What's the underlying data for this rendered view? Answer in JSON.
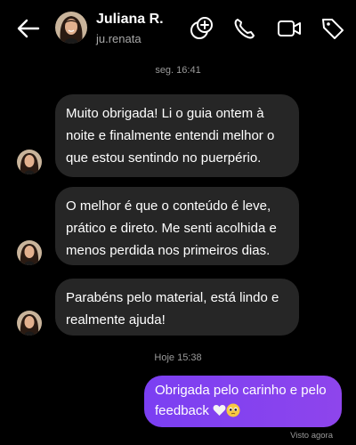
{
  "header": {
    "name": "Juliana R.",
    "username": "ju.renata",
    "icons": [
      "back-arrow-icon",
      "add-friend-icon",
      "phone-icon",
      "video-call-icon",
      "tag-icon"
    ]
  },
  "timestamps": {
    "first": "seg. 16:41",
    "second": "Hoje 15:38"
  },
  "messages": [
    {
      "from": "contact",
      "lines": [
        "Muito obrigada! Li o guia ontem à",
        "noite e finalmente entendi melhor o",
        "que estou sentindo no puerpério."
      ]
    },
    {
      "from": "contact",
      "lines": [
        "O melhor é que o conteúdo é leve,",
        "prático e direto. Me senti acolhida e",
        "menos perdida nos primeiros dias."
      ]
    },
    {
      "from": "contact",
      "lines": [
        "Parabéns pelo material, está lindo e",
        "realmente ajuda!"
      ]
    },
    {
      "from": "me",
      "lines": [
        "Obrigada pelo carinho e pelo",
        "feedback"
      ],
      "emoji": [
        "white-heart-icon",
        "pleading-face-icon"
      ]
    }
  ],
  "status": {
    "seen": "Visto agora"
  },
  "colors": {
    "background": "#000000",
    "incoming_bubble": "#262626",
    "outgoing_bubble": "#7b3ff2",
    "muted_text": "#9a9a9a"
  }
}
